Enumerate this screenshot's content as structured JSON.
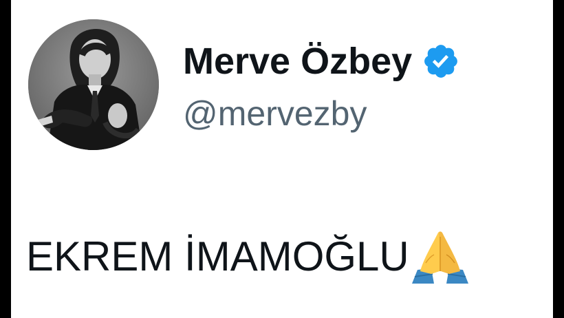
{
  "profile": {
    "display_name": "Merve Özbey",
    "handle": "@mervezby",
    "verified": true
  },
  "tweet": {
    "text": "EKREM İMAMOĞLU",
    "emoji": "folded-hands-icon"
  },
  "colors": {
    "name": "#0f1419",
    "handle": "#536471",
    "verified_badge": "#1d9bf0",
    "background": "#ffffff",
    "letterbox": "#000000"
  }
}
